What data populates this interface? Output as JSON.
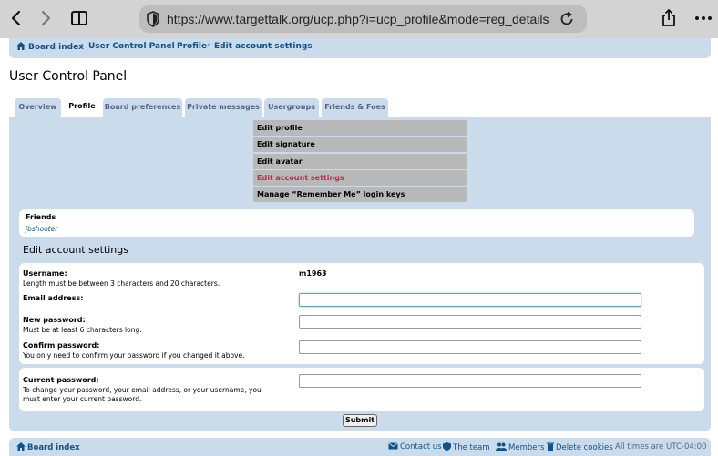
{
  "browser": {
    "url": "https://www.targettalk.org/ucp.php?i=ucp_profile&mode=reg_details"
  },
  "breadcrumbs": [
    "Board index",
    "User Control Panel",
    "Profile",
    "Edit account settings"
  ],
  "page_title": "User Control Panel",
  "tabs": [
    "Overview",
    "Profile",
    "Board preferences",
    "Private messages",
    "Usergroups",
    "Friends & Foes"
  ],
  "active_tab": "Profile",
  "submenu": [
    "Edit profile",
    "Edit signature",
    "Edit avatar",
    "Edit account settings",
    "Manage “Remember Me” login keys"
  ],
  "friends": {
    "title": "Friends",
    "name": "jbshooter"
  },
  "section_title": "Edit account settings",
  "form": {
    "username_label": "Username:",
    "username_hint": "Length must be between 3 characters and 20 characters.",
    "username_value": "m1963",
    "email_label": "Email address:",
    "new_password_label": "New password:",
    "new_password_hint": "Must be at least 6 characters long.",
    "confirm_password_label": "Confirm password:",
    "confirm_password_hint": "You only need to confirm your password if you changed it above.",
    "current_password_label": "Current password:",
    "current_password_hint_1": "To change your password, your email address, or your username, you",
    "current_password_hint_2": "must enter your current password.",
    "submit_label": "Submit"
  },
  "footer": {
    "board_index": "Board index",
    "contact": "Contact us",
    "team": "The team",
    "members": "Members",
    "delete_cookies": "Delete cookies",
    "timezone": "All times are UTC-04:00"
  },
  "colors": {
    "link": "#105289",
    "panel": "#cadceb",
    "active_menu": "#bc2a4d"
  }
}
